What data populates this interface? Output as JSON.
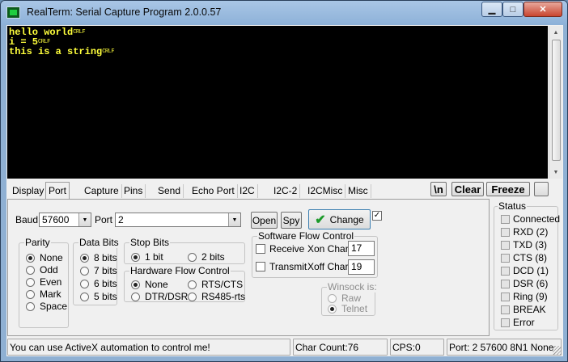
{
  "window": {
    "title": "RealTerm: Serial Capture Program 2.0.0.57",
    "min_glyph": "▁",
    "max_glyph": "□",
    "close_glyph": "✕"
  },
  "terminal": {
    "lines": [
      {
        "text": "hello world",
        "end": "CRLF"
      },
      {
        "text": "i = 5",
        "end": "CRLF"
      },
      {
        "text": "this is a string",
        "end": "CRLF"
      }
    ],
    "text_color": "#ffff3c",
    "background": "#000000"
  },
  "tabs": [
    {
      "label": "Display",
      "active": false
    },
    {
      "label": "Port",
      "active": true
    },
    {
      "label": "Capture",
      "active": false
    },
    {
      "label": "Pins",
      "active": false
    },
    {
      "label": "Send",
      "active": false
    },
    {
      "label": "Echo Port",
      "active": false
    },
    {
      "label": "I2C",
      "active": false
    },
    {
      "label": "I2C-2",
      "active": false
    },
    {
      "label": "I2CMisc",
      "active": false
    },
    {
      "label": "Misc",
      "active": false
    }
  ],
  "toolbar": {
    "newline_label": "\\n",
    "clear_label": "Clear",
    "freeze_label": "Freeze"
  },
  "port": {
    "baud_label": "Baud",
    "baud_value": "57600",
    "port_label": "Port",
    "port_value": "2",
    "open_label": "Open",
    "spy_label": "Spy",
    "change_label": "Change",
    "change_checked": true
  },
  "parity": {
    "title": "Parity",
    "options": [
      "None",
      "Odd",
      "Even",
      "Mark",
      "Space"
    ],
    "selected": "None"
  },
  "data_bits": {
    "title": "Data Bits",
    "options": [
      "8 bits",
      "7 bits",
      "6 bits",
      "5 bits"
    ],
    "selected": "8 bits"
  },
  "stop_bits": {
    "title": "Stop Bits",
    "options": [
      "1 bit",
      "2 bits"
    ],
    "selected": "1 bit"
  },
  "hw_flow": {
    "title": "Hardware Flow Control",
    "options": [
      "None",
      "RTS/CTS",
      "DTR/DSR",
      "RS485-rts"
    ],
    "selected": "None"
  },
  "sw_flow": {
    "title": "Software Flow Control",
    "receive_label": "Receive",
    "transmit_label": "Transmit",
    "receive_checked": false,
    "transmit_checked": false,
    "xon_label": "Xon Char:",
    "xon_value": "17",
    "xoff_label": "Xoff Char:",
    "xoff_value": "19"
  },
  "winsock": {
    "title": "Winsock is:",
    "options": [
      "Raw",
      "Telnet"
    ],
    "selected": "Telnet"
  },
  "status": {
    "title": "Status",
    "items": [
      "Connected",
      "RXD (2)",
      "TXD (3)",
      "CTS (8)",
      "DCD (1)",
      "DSR (6)",
      "Ring (9)",
      "BREAK",
      "Error"
    ]
  },
  "statusbar": {
    "message": "You can use ActiveX automation to control me!",
    "char_count": "Char Count:76",
    "cps": "CPS:0",
    "port_info": "Port: 2 57600 8N1 None"
  }
}
